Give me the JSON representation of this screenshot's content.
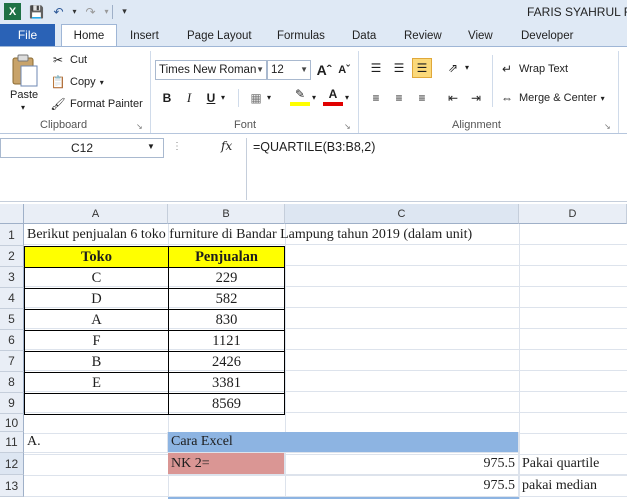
{
  "window": {
    "title": "FARIS SYAHRUL RA"
  },
  "tabs": {
    "file": "File",
    "home": "Home",
    "insert": "Insert",
    "page_layout": "Page Layout",
    "formulas": "Formulas",
    "data": "Data",
    "review": "Review",
    "view": "View",
    "developer": "Developer"
  },
  "clipboard": {
    "paste": "Paste",
    "cut": "Cut",
    "copy": "Copy",
    "format_painter": "Format Painter",
    "label": "Clipboard"
  },
  "font": {
    "name": "Times New Roman",
    "size": "12",
    "bold": "B",
    "italic": "I",
    "underline": "U",
    "label": "Font"
  },
  "alignment": {
    "wrap_text": "Wrap Text",
    "merge_center": "Merge & Center",
    "label": "Alignment"
  },
  "formula_bar": {
    "name_box": "C12",
    "fx": "fx",
    "formula": "=QUARTILE(B3:B8,2)"
  },
  "columns": [
    "A",
    "B",
    "C",
    "D"
  ],
  "rows": [
    "1",
    "2",
    "3",
    "4",
    "5",
    "6",
    "7",
    "8",
    "9",
    "10",
    "11",
    "12",
    "13"
  ],
  "sheet": {
    "r1": {
      "a": "Berikut penjualan 6 toko furniture di Bandar Lampung tahun 2019 (dalam unit)"
    },
    "header": {
      "toko": "Toko",
      "penjualan": "Penjualan"
    },
    "data": [
      {
        "toko": "C",
        "val": "229"
      },
      {
        "toko": "D",
        "val": "582"
      },
      {
        "toko": "A",
        "val": "830"
      },
      {
        "toko": "F",
        "val": "1121"
      },
      {
        "toko": "B",
        "val": "2426"
      },
      {
        "toko": "E",
        "val": "3381"
      },
      {
        "toko": "",
        "val": "8569"
      }
    ],
    "r11": {
      "a": "A.",
      "b": "Cara Excel"
    },
    "r12": {
      "b": "NK 2=",
      "c": "975.5",
      "d": "Pakai quartile"
    },
    "r13": {
      "c": "975.5",
      "d": "pakai median"
    }
  },
  "colors": {
    "accent": "#2a62b6",
    "header_fill": "#ffff00",
    "blue_fill": "#8db4e2",
    "red_fill": "#da9694"
  }
}
